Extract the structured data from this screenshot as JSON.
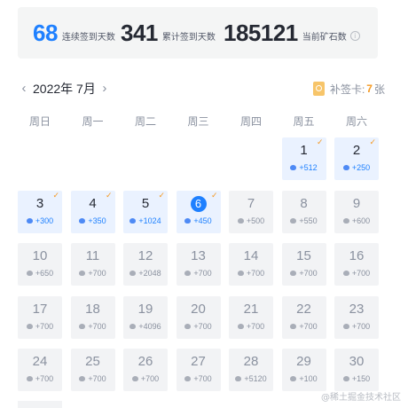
{
  "stats": [
    {
      "value": "68",
      "label": "连续签到天数"
    },
    {
      "value": "341",
      "label": "累计签到天数"
    },
    {
      "value": "185121",
      "label": "当前矿石数"
    }
  ],
  "info_icon_glyph": "i",
  "calendar": {
    "prev_glyph": "‹",
    "next_glyph": "›",
    "month_label": "2022年 7月",
    "card_label": "补签卡:",
    "card_count": "7",
    "card_unit": "张",
    "weekdays": [
      "周日",
      "周一",
      "周二",
      "周三",
      "周四",
      "周五",
      "周六"
    ],
    "first_weekday_index": 5,
    "days": [
      {
        "day": "1",
        "points": "+512",
        "signed": true,
        "checked": true
      },
      {
        "day": "2",
        "points": "+250",
        "signed": true,
        "checked": true
      },
      {
        "day": "3",
        "points": "+300",
        "signed": true,
        "checked": true
      },
      {
        "day": "4",
        "points": "+350",
        "signed": true,
        "checked": true
      },
      {
        "day": "5",
        "points": "+1024",
        "signed": true,
        "checked": true
      },
      {
        "day": "6",
        "points": "+450",
        "signed": true,
        "checked": true,
        "today": true
      },
      {
        "day": "7",
        "points": "+500",
        "signed": false
      },
      {
        "day": "8",
        "points": "+550",
        "signed": false
      },
      {
        "day": "9",
        "points": "+600",
        "signed": false
      },
      {
        "day": "10",
        "points": "+650",
        "signed": false
      },
      {
        "day": "11",
        "points": "+700",
        "signed": false
      },
      {
        "day": "12",
        "points": "+2048",
        "signed": false
      },
      {
        "day": "13",
        "points": "+700",
        "signed": false
      },
      {
        "day": "14",
        "points": "+700",
        "signed": false
      },
      {
        "day": "15",
        "points": "+700",
        "signed": false
      },
      {
        "day": "16",
        "points": "+700",
        "signed": false
      },
      {
        "day": "17",
        "points": "+700",
        "signed": false
      },
      {
        "day": "18",
        "points": "+700",
        "signed": false
      },
      {
        "day": "19",
        "points": "+4096",
        "signed": false
      },
      {
        "day": "20",
        "points": "+700",
        "signed": false
      },
      {
        "day": "21",
        "points": "+700",
        "signed": false
      },
      {
        "day": "22",
        "points": "+700",
        "signed": false
      },
      {
        "day": "23",
        "points": "+700",
        "signed": false
      },
      {
        "day": "24",
        "points": "+700",
        "signed": false
      },
      {
        "day": "25",
        "points": "+700",
        "signed": false
      },
      {
        "day": "26",
        "points": "+700",
        "signed": false
      },
      {
        "day": "27",
        "points": "+700",
        "signed": false
      },
      {
        "day": "28",
        "points": "+5120",
        "signed": false
      },
      {
        "day": "29",
        "points": "+100",
        "signed": false
      },
      {
        "day": "30",
        "points": "+150",
        "signed": false
      }
    ],
    "check_glyph": "✓"
  },
  "watermark": "@稀土掘金技术社区"
}
